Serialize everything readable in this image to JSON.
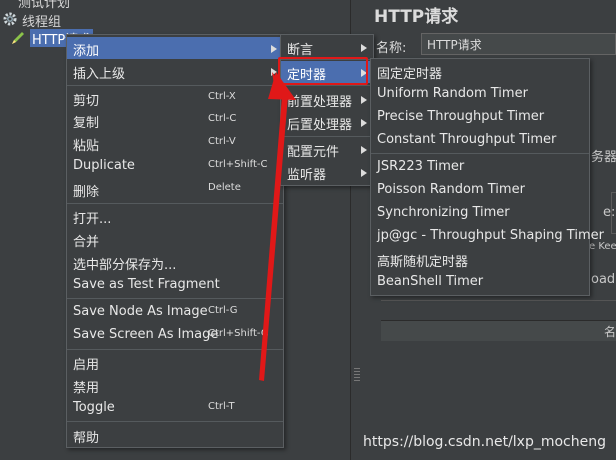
{
  "tree": {
    "items": [
      {
        "label": "测试计划"
      },
      {
        "label": "线程组"
      },
      {
        "label": "HTTP请求"
      }
    ]
  },
  "right": {
    "title": "HTTP请求",
    "name_label": "名称:",
    "name_value": "HTTP请求",
    "ghost_server": "务器",
    "ghost_colon": "e:",
    "ghost_keep": "e Kee",
    "ghost_oad": "oad",
    "table_header": "名"
  },
  "context_menu": {
    "add": "添加",
    "insert_parent": "插入上级",
    "cut": "剪切",
    "cut_sc": "Ctrl-X",
    "copy": "复制",
    "copy_sc": "Ctrl-C",
    "paste": "粘贴",
    "paste_sc": "Ctrl-V",
    "duplicate": "Duplicate",
    "duplicate_sc": "Ctrl+Shift-C",
    "delete": "删除",
    "delete_sc": "Delete",
    "open": "打开...",
    "merge": "合并",
    "save_selection": "选中部分保存为...",
    "save_fragment": "Save as Test Fragment",
    "save_node_image": "Save Node As Image",
    "save_node_image_sc": "Ctrl-G",
    "save_screen_image": "Save Screen As Image",
    "save_screen_image_sc": "Ctrl+Shift-G",
    "enable": "启用",
    "disable": "禁用",
    "toggle": "Toggle",
    "toggle_sc": "Ctrl-T",
    "help": "帮助"
  },
  "add_submenu": {
    "assertion": "断言",
    "timer": "定时器",
    "pre_processor": "前置处理器",
    "post_processor": "后置处理器",
    "config_element": "配置元件",
    "listener": "监听器"
  },
  "timer_submenu": {
    "items": [
      "固定定时器",
      "Uniform Random Timer",
      "Precise Throughput Timer",
      "Constant Throughput Timer",
      "JSR223 Timer",
      "Poisson Random Timer",
      "Synchronizing Timer",
      "jp@gc - Throughput Shaping Timer",
      "高斯随机定时器",
      "BeanShell Timer"
    ]
  },
  "colors": {
    "selection": "#4b6eaf",
    "annotation": "#e01818"
  },
  "watermark": "https://blog.csdn.net/lxp_mocheng"
}
